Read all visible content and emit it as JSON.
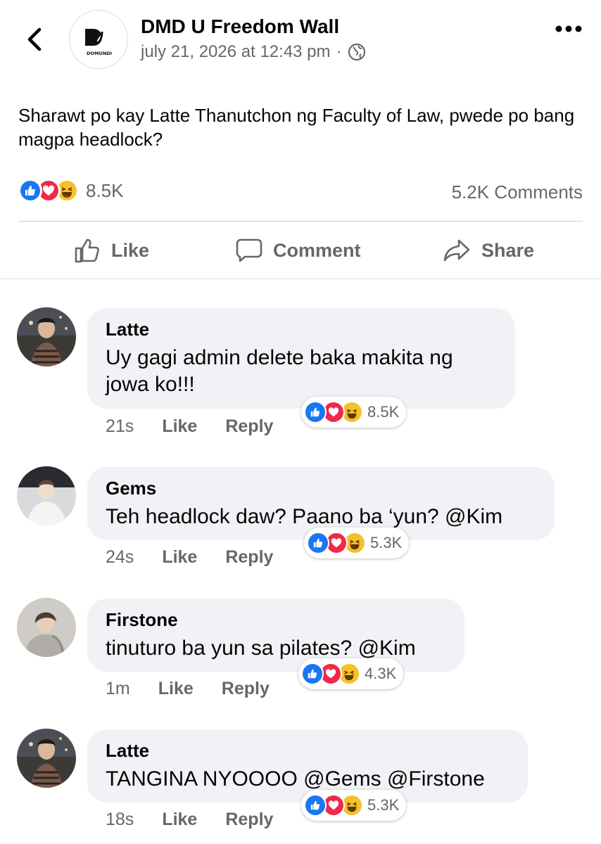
{
  "header": {
    "page_name": "DMD U Freedom Wall",
    "timestamp": "july 21, 2026 at 12:43 pm",
    "separator": "·",
    "logo_text": "DOMUNDI",
    "icons": {
      "back": "chevron-left-icon",
      "more": "more-horizontal-icon",
      "audience": "globe-icon"
    }
  },
  "post": {
    "text": "Sharawt po kay Latte Thanutchon ng Faculty of Law, pwede po bang magpa headlock?",
    "reaction_count": "8.5K",
    "comments_count": "5.2K Comments"
  },
  "actions": {
    "like": "Like",
    "comment": "Comment",
    "share": "Share"
  },
  "comments": [
    {
      "author": "Latte",
      "text": "Uy gagi admin delete baka makita ng jowa ko!!!",
      "time": "21s",
      "like": "Like",
      "reply": "Reply",
      "reactions": "8.5K"
    },
    {
      "author": "Gems",
      "text": "Teh headlock daw? Paano ba ‘yun? @Kim",
      "time": "24s",
      "like": "Like",
      "reply": "Reply",
      "reactions": "5.3K"
    },
    {
      "author": "Firstone",
      "text": "tinuturo ba yun sa pilates? @Kim",
      "time": "1m",
      "like": "Like",
      "reply": "Reply",
      "reactions": "4.3K"
    },
    {
      "author": "Latte",
      "text": "TANGINA NYOOOO @Gems @Firstone",
      "time": "18s",
      "like": "Like",
      "reply": "Reply",
      "reactions": "5.3K"
    }
  ],
  "colors": {
    "like_blue": "#1a77f2",
    "love_red": "#f0284a",
    "haha_yellow": "#f7c02b",
    "secondary_text": "#65676b",
    "bubble_bg": "#f0f2f5"
  }
}
